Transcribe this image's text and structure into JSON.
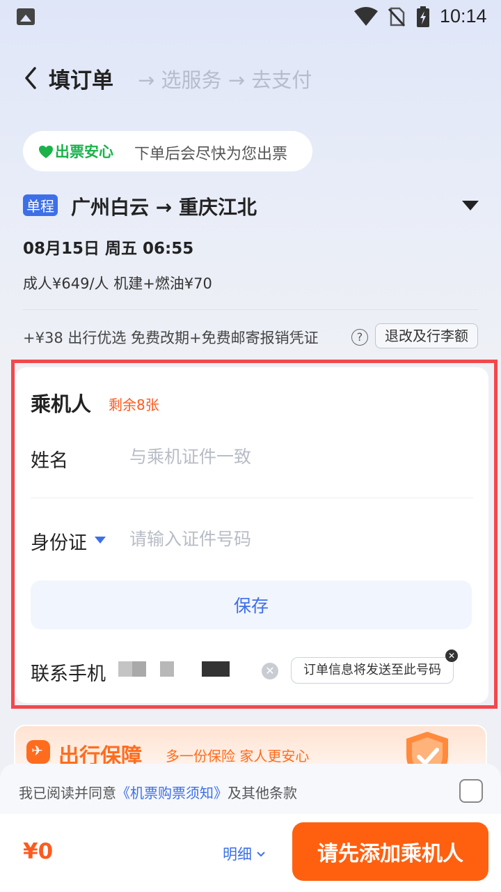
{
  "status_bar": {
    "time": "10:14"
  },
  "header": {
    "step_current": "填订单",
    "step_rest": "→ 选服务 → 去支付"
  },
  "assurance": {
    "brand": "出票安心",
    "text": "下单后会尽快为您出票"
  },
  "flight": {
    "trip_type": "单程",
    "route": "广州白云 → 重庆江北",
    "date": "08月15日 周五 06:55",
    "price_line": "成人¥649/人  机建+燃油¥70",
    "extra": "+¥38 出行优选 免费改期+免费邮寄报销凭证",
    "refund_button": "退改及行李额"
  },
  "passenger": {
    "title": "乘机人",
    "remaining": "剩余8张",
    "name_label": "姓名",
    "name_placeholder": "与乘机证件一致",
    "id_label": "身份证",
    "id_placeholder": "请输入证件号码",
    "save_button": "保存",
    "phone_label": "联系手机",
    "phone_tooltip": "订单信息将发送至此号码"
  },
  "insurance": {
    "title": "出行保障",
    "subtitle": "多一份保险 家人更安心"
  },
  "agreement": {
    "prefix": "我已阅读并同意",
    "link": "《机票购票须知》",
    "suffix": "及其他条款"
  },
  "footer": {
    "total": "¥0",
    "detail": "明细",
    "submit": "请先添加乘机人"
  },
  "colors": {
    "accent_blue": "#3d6fe8",
    "accent_orange": "#ff6010",
    "assurance_green": "#19b34a",
    "highlight_red": "#f2484d"
  }
}
